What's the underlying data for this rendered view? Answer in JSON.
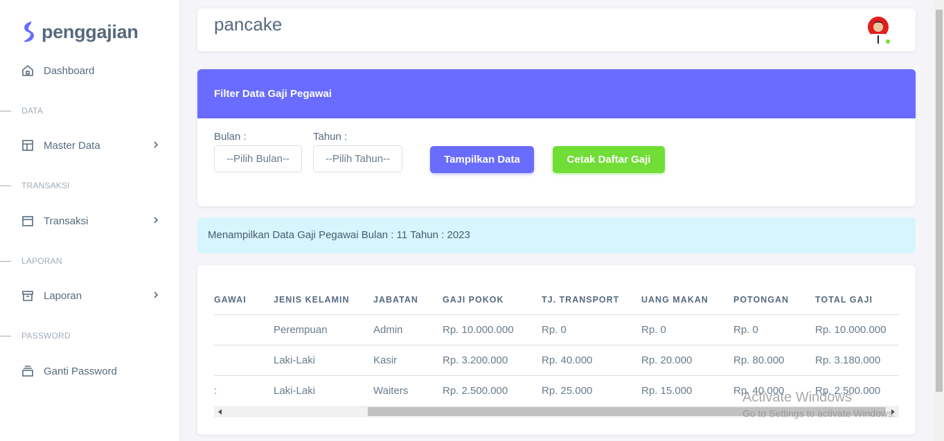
{
  "brand": {
    "name": "penggajian",
    "color": "#696cff"
  },
  "sidebar": {
    "dashboard": {
      "label": "Dashboard",
      "icon": "home-icon"
    },
    "sections": {
      "data": "DATA",
      "transaksi": "TRANSAKSI",
      "laporan": "LAPORAN",
      "password": "PASSWORD"
    },
    "master_data": {
      "label": "Master Data",
      "icon": "layout-icon"
    },
    "transaksi": {
      "label": "Transaksi",
      "icon": "calendar-icon"
    },
    "laporan": {
      "label": "Laporan",
      "icon": "archive-icon"
    },
    "ganti_password": {
      "label": "Ganti Password",
      "icon": "stack-icon"
    }
  },
  "navbar": {
    "title": "pancake",
    "status_color": "#71dd37"
  },
  "filter": {
    "title": "Filter Data Gaji Pegawai",
    "bulan_label": "Bulan :",
    "bulan_value": "--Pilih Bulan--",
    "tahun_label": "Tahun :",
    "tahun_value": "--Pilih Tahun--",
    "tampilkan_label": "Tampilkan Data",
    "cetak_label": "Cetak Daftar Gaji"
  },
  "alert": {
    "text": "Menampilkan Data Gaji Pegawai Bulan : 11 Tahun : 2023"
  },
  "table": {
    "headers": [
      "GAWAI",
      "JENIS KELAMIN",
      "JABATAN",
      "GAJI POKOK",
      "TJ. TRANSPORT",
      "UANG MAKAN",
      "POTONGAN",
      "TOTAL GAJI"
    ],
    "rows": [
      [
        "",
        "Perempuan",
        "Admin",
        "Rp. 10.000.000",
        "Rp. 0",
        "Rp. 0",
        "Rp. 0",
        "Rp. 10.000.000"
      ],
      [
        "",
        "Laki-Laki",
        "Kasir",
        "Rp. 3.200.000",
        "Rp. 40.000",
        "Rp. 20.000",
        "Rp. 80.000",
        "Rp. 3.180.000"
      ],
      [
        ":",
        "Laki-Laki",
        "Waiters",
        "Rp. 2.500.000",
        "Rp. 25.000",
        "Rp. 15.000",
        "Rp. 40.000",
        "Rp. 2.500.000"
      ]
    ]
  },
  "watermark": {
    "line1": "Activate Windows",
    "line2": "Go to Settings to activate Windows."
  }
}
